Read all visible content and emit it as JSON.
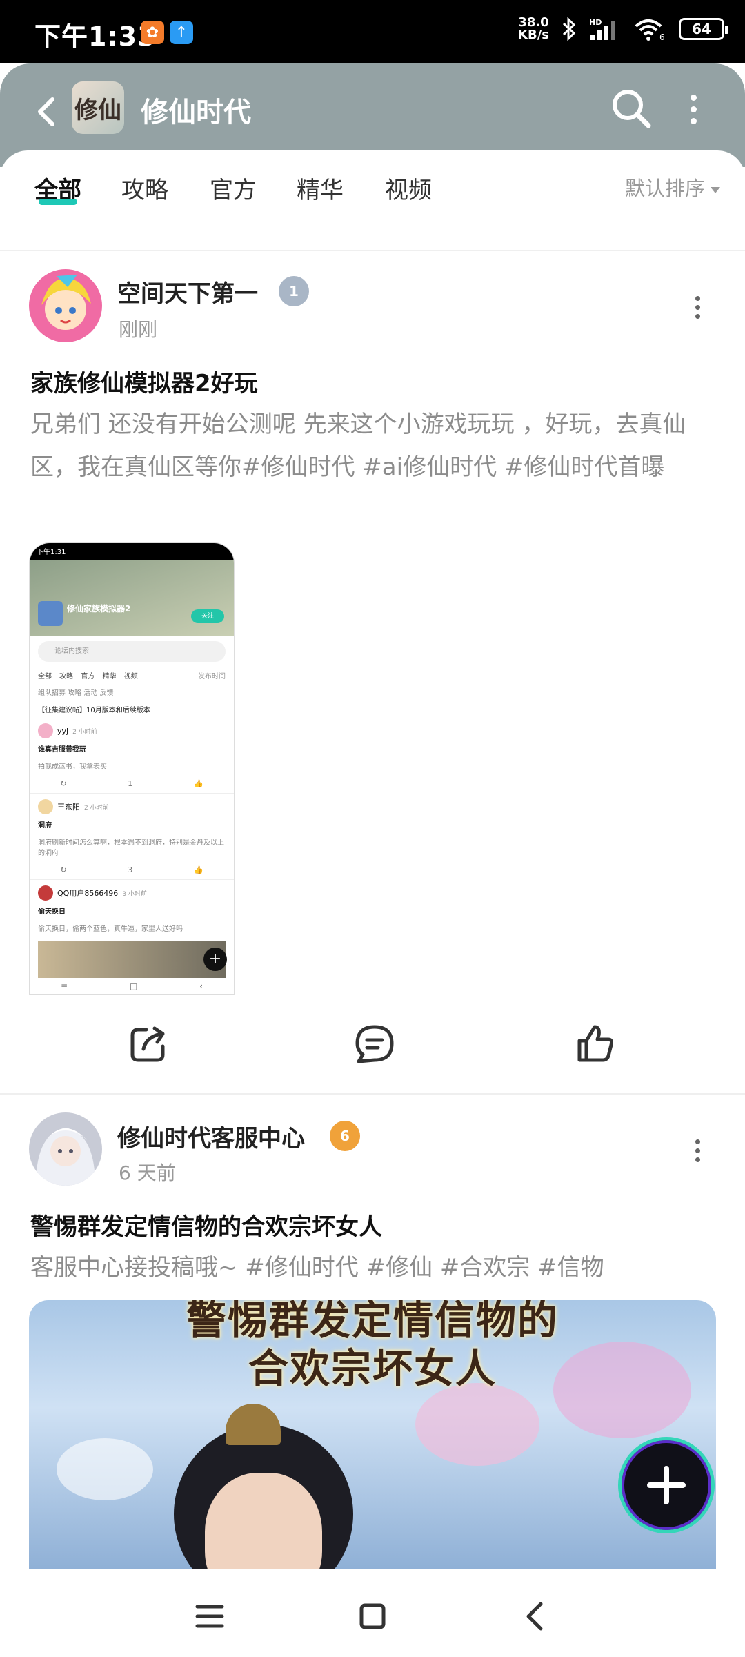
{
  "status_bar": {
    "time": "下午1:33",
    "net_speed_value": "38.0",
    "net_speed_unit": "KB/s",
    "battery": "64"
  },
  "header": {
    "forum_name": "修仙时代",
    "icon_text": "修仙"
  },
  "tabs": [
    {
      "label": "全部",
      "active": true
    },
    {
      "label": "攻略",
      "active": false
    },
    {
      "label": "官方",
      "active": false
    },
    {
      "label": "精华",
      "active": false
    },
    {
      "label": "视频",
      "active": false
    }
  ],
  "sort_label": "默认排序",
  "posts": [
    {
      "user": "空间天下第一",
      "level": "1",
      "time": "刚刚",
      "title": "家族修仙模拟器2好玩",
      "body": "兄弟们 还没有开始公测呢 先来这个小游戏玩玩 ，好玩，去真仙区，我在真仙区等你#修仙时代 #ai修仙时代 #修仙时代首曝",
      "thumbnail": {
        "status_time": "下午1:31",
        "forum_name": "修仙家族模拟器2",
        "follow": "关注",
        "search_placeholder": "论坛内搜索",
        "tabs": "全部 攻略 官方 精华 视频",
        "sort": "发布时间",
        "filters": "组队招募 攻略 活动 反馈",
        "pinned": "【征集建议帖】10月版本和后续版本",
        "entries": [
          {
            "user": "yyj",
            "time": "2 小时前",
            "title": "谁真吉服带我玩",
            "body": "拍我成蓝书，我拿表买",
            "comments": "1"
          },
          {
            "user": "王东阳",
            "time": "2 小时前",
            "title": "洞府",
            "body": "洞府刷新时间怎么算啊，根本遇不到洞府，特别是金丹及以上的洞府",
            "comments": "3"
          },
          {
            "user": "QQ用户8566496",
            "time": "3 小时前",
            "title": "偷天换日",
            "body": "偷天换日，偷两个蓝色，真牛逼，家里人送好吗"
          }
        ]
      }
    },
    {
      "user": "修仙时代客服中心",
      "level": "6",
      "time": "6 天前",
      "title": "警惕群发定情信物的合欢宗坏女人",
      "body": "客服中心接投稿哦~ #修仙时代 #修仙 #合欢宗 #信物",
      "video_caption_line1": "警惕群发定情信物的",
      "video_caption_line2": "合欢宗坏女人"
    }
  ],
  "colors": {
    "header_bg": "#94a2a4",
    "accent": "#1ec8b6",
    "badge_grey": "#a9b6c6",
    "badge_orange": "#f0a23a"
  }
}
